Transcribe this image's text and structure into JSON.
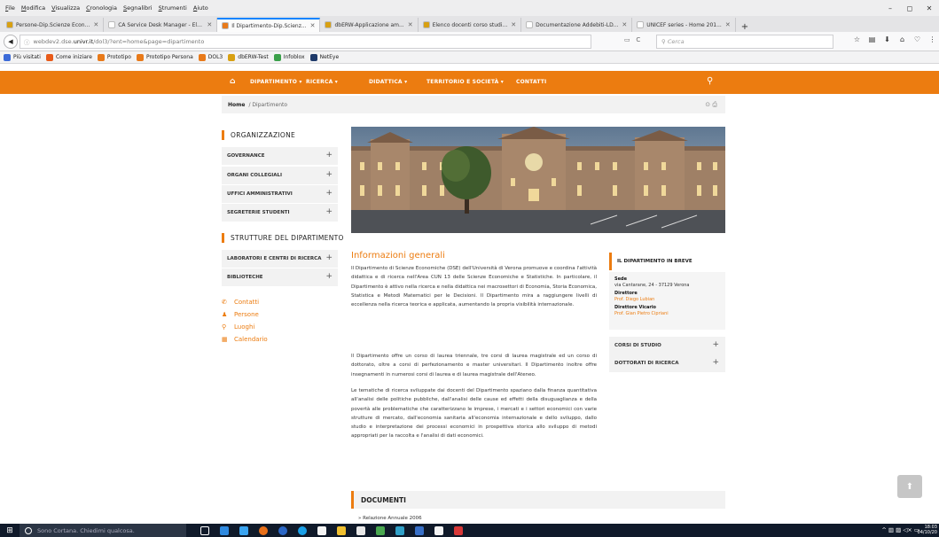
{
  "browser": {
    "menu": [
      "File",
      "Modifica",
      "Visualizza",
      "Cronologia",
      "Segnalibri",
      "Strumenti",
      "Aiuto"
    ],
    "window_controls": [
      "–",
      "◻",
      "✕"
    ],
    "tabs": [
      {
        "title": "Persone-Dip.Scienze Econ...",
        "color": "#d8a012",
        "active": false
      },
      {
        "title": "CA Service Desk Manager - Ele...",
        "color": "#ffffff",
        "active": false
      },
      {
        "title": "Il Dipartimento-Dip.Scienz...",
        "color": "#e87a1a",
        "active": true
      },
      {
        "title": "dbERW-Applicazione am...",
        "color": "#d8a012",
        "active": false
      },
      {
        "title": "Elenco docenti corso studi...",
        "color": "#d8a012",
        "active": false
      },
      {
        "title": "Documentazione Addebiti-LD...",
        "color": "#ffffff",
        "active": false
      },
      {
        "title": "UNICEF series - Home 201...",
        "color": "#ffffff",
        "active": false
      }
    ],
    "new_tab": "+",
    "url_prefix": "webdev2.dse.",
    "url_domain": "univr.it",
    "url_path": "/dol3/?ent=home&page=dipartimento",
    "reload": "C",
    "search_placeholder": "Cerca",
    "bookmarks": [
      {
        "label": "Più visitati",
        "color": "#3b6ad8"
      },
      {
        "label": "Come iniziare",
        "color": "#e85b1a"
      },
      {
        "label": "Prototipo",
        "color": "#e87a1a"
      },
      {
        "label": "Prototipo Persona",
        "color": "#e87a1a"
      },
      {
        "label": "DOL3",
        "color": "#e87a1a"
      },
      {
        "label": "dbERW-Test",
        "color": "#d8a012"
      },
      {
        "label": "Infoblox",
        "color": "#3aa04a"
      },
      {
        "label": "NetEye",
        "color": "#1e3a6a"
      }
    ]
  },
  "site": {
    "nav": [
      "DIPARTIMENTO",
      "RICERCA",
      "DIDATTICA",
      "TERRITORIO E SOCIETÀ",
      "CONTATTI"
    ],
    "breadcrumb": {
      "home": "Home",
      "sep": "/",
      "current": "Dipartimento"
    },
    "sidebar": {
      "org_title": "ORGANIZZAZIONE",
      "org_items": [
        "GOVERNANCE",
        "ORGANI COLLEGIALI",
        "UFFICI AMMINISTRATIVI",
        "SEGRETERIE STUDENTI"
      ],
      "strutture_title": "STRUTTURE DEL DIPARTIMENTO",
      "strutture_items": [
        "LABORATORI E CENTRI DI RICERCA",
        "BIBLIOTECHE"
      ],
      "links": [
        {
          "label": "Contatti",
          "icon": "phone-icon"
        },
        {
          "label": "Persone",
          "icon": "person-icon"
        },
        {
          "label": "Luoghi",
          "icon": "location-pin-icon"
        },
        {
          "label": "Calendario",
          "icon": "calendar-icon"
        }
      ]
    },
    "main": {
      "title": "Informazioni generali",
      "paragraphs": [
        "Il Dipartimento di Scienze Economiche (DSE) dell'Università di Verona promuove e coordina l'attività didattica e di ricerca nell'Area CUN 13 delle Scienze Economiche e Statistiche. In particolare, il Dipartimento è attivo nella ricerca e nella didattica nei macrosettori di Economia, Storia Economica, Statistica e Metodi Matematici per le Decisioni. Il Dipartimento mira a raggiungere livelli di eccellenza nella ricerca teorica e applicata, aumentando la propria visibilità internazionale.",
        "Il Dipartimento offre un corso di laurea triennale, tre corsi di laurea magistrale ed un corso di dottorato, oltre a corsi di perfezionamento e master universitari. Il Dipartimento inoltre offre insegnamenti in numerosi corsi di laurea e di laurea magistrale dell'Ateneo.",
        "Le tematiche di ricerca sviluppate dai docenti del Dipartimento spaziano dalla finanza quantitativa all'analisi delle politiche pubbliche, dall'analisi delle cause ed effetti della disuguaglianza e della povertà alle problematiche che caratterizzano le imprese, i mercati e i settori economici con varie strutture di mercato, dall'economia sanitaria all'economia internazionale e dello sviluppo, dallo studio e interpretazione dei processi economici in prospettiva storica allo sviluppo di metodi appropriati per la raccolta e l'analisi di dati economici."
      ],
      "documents_title": "DOCUMENTI",
      "documents": [
        "Relazione Annuale 2006"
      ]
    },
    "breve": {
      "title": "IL DIPARTIMENTO IN BREVE",
      "sede_label": "Sede",
      "sede_value": "via Cantarane, 24 - 37129 Verona",
      "direttore_label": "Direttore",
      "direttore_value": "Prof. Diego Lubian",
      "vicario_label": "Direttore Vicario",
      "vicario_value": "Prof. Gian Pietro Cipriani",
      "acc": [
        "CORSI DI STUDIO",
        "DOTTORATI DI RICERCA"
      ]
    },
    "accent": "#ec7c10"
  },
  "taskbar": {
    "cortana": "Sono Cortana. Chiedimi qualcosa.",
    "time": "18:03",
    "date": "04/10/20"
  }
}
